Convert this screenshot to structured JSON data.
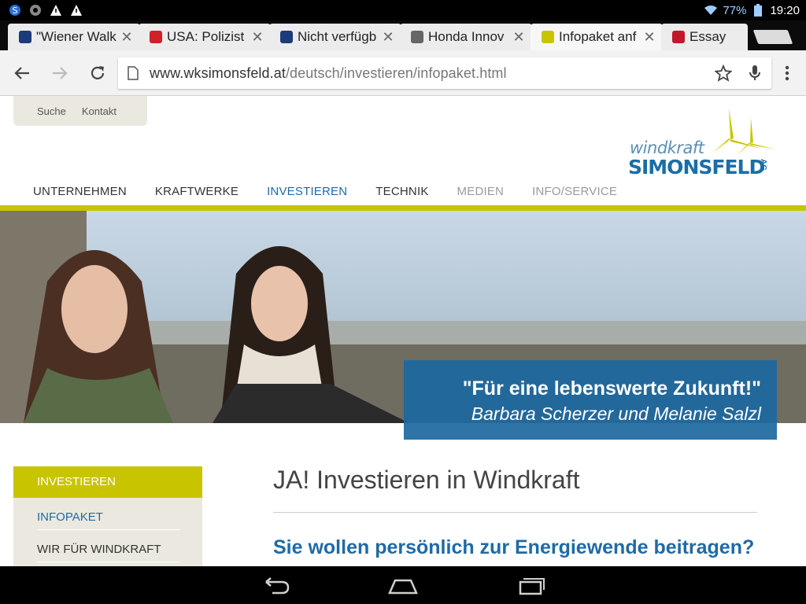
{
  "status": {
    "battery_pct": "77%",
    "time": "19:20"
  },
  "tabs": [
    {
      "title": "\"Wiener Walk",
      "fav": "#1b3b7a",
      "active": false
    },
    {
      "title": "USA: Polizist",
      "fav": "#d0202a",
      "active": false
    },
    {
      "title": "Nicht verfügb",
      "fav": "#1b3b7a",
      "active": false
    },
    {
      "title": "Honda Innov",
      "fav": "#666666",
      "active": false
    },
    {
      "title": "Infopaket anf",
      "fav": "#c9c400",
      "active": true
    },
    {
      "title": "Essay",
      "fav": "#c0182a",
      "active": false
    }
  ],
  "omnibox": {
    "host": "www.wksimonsfeld.at",
    "path": "/deutsch/investieren/infopaket.html"
  },
  "util_links": {
    "search": "Suche",
    "contact": "Kontakt"
  },
  "logo": {
    "line1": "windkraft",
    "line2": "SIMONSFELD",
    "suffix": "AG"
  },
  "main_nav": [
    "UNTERNEHMEN",
    "KRAFTWERKE",
    "INVESTIEREN",
    "TECHNIK",
    "MEDIEN",
    "INFO/SERVICE"
  ],
  "hero": {
    "quote": "\"Für eine lebenswerte Zukunft!\"",
    "author": "Barbara Scherzer und Melanie Salzl"
  },
  "sidebar": {
    "heading": "INVESTIEREN",
    "items": [
      "INFOPAKET",
      "WIR FÜR WINDKRAFT"
    ]
  },
  "content": {
    "title": "JA! Investieren in Windkraft",
    "subtitle": "Sie wollen persönlich zur Energiewende beitragen?"
  },
  "colors": {
    "brand_blue": "#1f6aa6",
    "brand_yellow": "#c9c400"
  }
}
